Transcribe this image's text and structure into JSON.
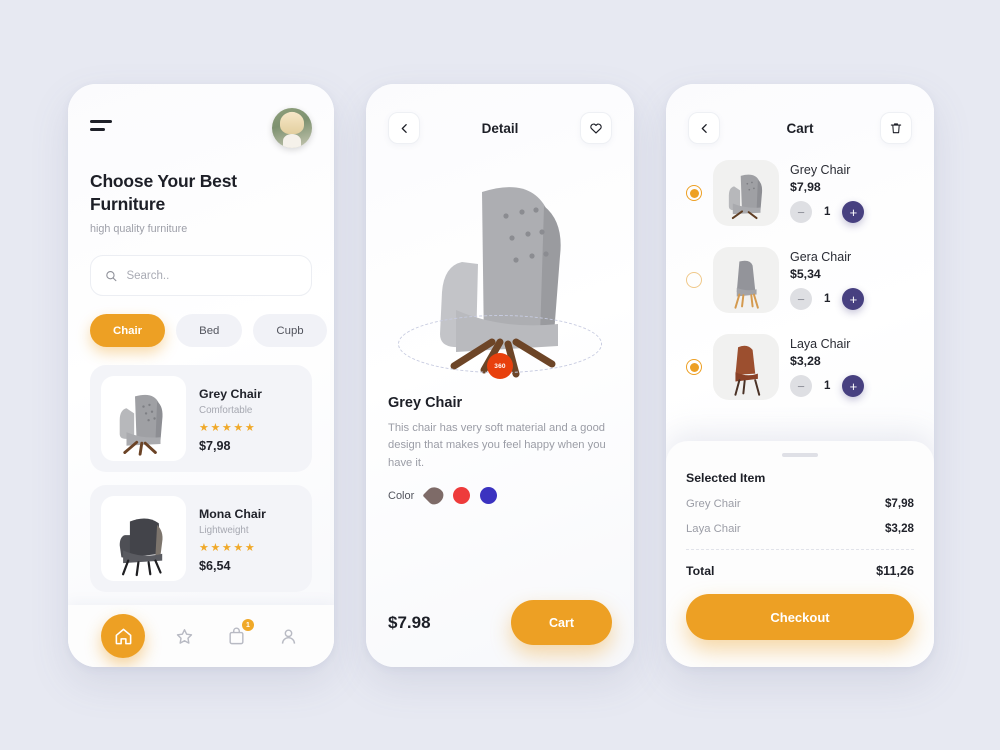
{
  "theme": {
    "accent": "#eda024",
    "indigo": "#474080",
    "badge_red": "#e8400d",
    "bg": "#e7e9f2"
  },
  "home": {
    "menu_icon": "hamburger-icon",
    "avatar": "user-avatar",
    "title": "Choose Your Best Furniture",
    "subtitle": "high quality furniture",
    "search": {
      "placeholder": "Search..",
      "value": "",
      "icon": "search-icon"
    },
    "chips": [
      {
        "label": "Chair",
        "active": true
      },
      {
        "label": "Bed",
        "active": false
      },
      {
        "label": "Cupb",
        "active": false
      }
    ],
    "products": [
      {
        "name": "Grey Chair",
        "tag": "Comfortable",
        "stars": "★★★★★",
        "price": "$7,98"
      },
      {
        "name": "Mona Chair",
        "tag": "Lightweight",
        "stars": "★★★★★",
        "price": "$6,54"
      }
    ],
    "tabs": [
      {
        "icon": "home-icon",
        "active": true,
        "badge": ""
      },
      {
        "icon": "star-icon",
        "active": false,
        "badge": ""
      },
      {
        "icon": "bag-icon",
        "active": false,
        "badge": "1"
      },
      {
        "icon": "profile-icon",
        "active": false,
        "badge": ""
      }
    ]
  },
  "detail": {
    "back_icon": "chevron-left-icon",
    "title": "Detail",
    "favorite_icon": "heart-icon",
    "rotate_badge": "360",
    "product_name": "Grey Chair",
    "description": "This chair has very soft material and a good design that makes you feel happy when you have it.",
    "color_label": "Color",
    "colors": [
      {
        "name": "taupe",
        "hex": "#7e6b68",
        "selected": true
      },
      {
        "name": "red",
        "hex": "#ee3b3b",
        "selected": false
      },
      {
        "name": "blue",
        "hex": "#3b32c0",
        "selected": false
      }
    ],
    "price": "$7.98",
    "cart_button": "Cart"
  },
  "cart": {
    "back_icon": "chevron-left-icon",
    "title": "Cart",
    "delete_icon": "trash-icon",
    "items": [
      {
        "name": "Grey Chair",
        "price": "$7,98",
        "qty": "1",
        "selected": true
      },
      {
        "name": "Gera Chair",
        "price": "$5,34",
        "qty": "1",
        "selected": false
      },
      {
        "name": "Laya Chair",
        "price": "$3,28",
        "qty": "1",
        "selected": true
      }
    ],
    "sheet": {
      "title": "Selected Item",
      "lines": [
        {
          "name": "Grey Chair",
          "price": "$7,98"
        },
        {
          "name": "Laya Chair",
          "price": "$3,28"
        }
      ],
      "total_label": "Total",
      "total_value": "$11,26",
      "checkout_label": "Checkout"
    }
  }
}
